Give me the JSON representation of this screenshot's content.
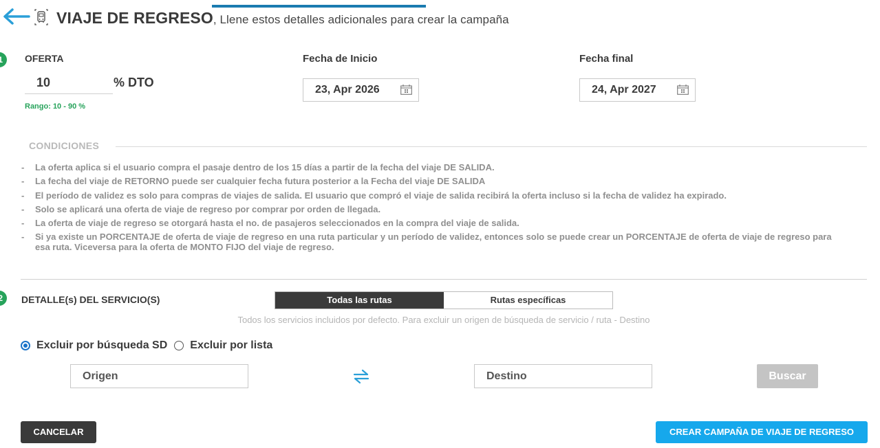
{
  "header": {
    "title": "VIAJE DE REGRESO",
    "subtitle": ", Llene estos detalles adicionales para crear la campaña",
    "back_icon": "back-arrow-icon",
    "bus_icon": "bus-icon",
    "accent_color": "#1a7bb0"
  },
  "step1": {
    "badge": "1",
    "offer_label": "OFERTA",
    "offer_value": "10",
    "offer_unit": "% DTO",
    "range_text": "Rango: 10 - 90 %",
    "start_label": "Fecha de Inicio",
    "start_value": "23, Apr 2026",
    "end_label": "Fecha final",
    "end_value": "24, Apr 2027"
  },
  "conditions": {
    "title": "CONDICIONES",
    "items": [
      "La oferta aplica si el usuario compra el pasaje dentro de los 15 días a partir de la fecha del viaje DE SALIDA.",
      "La fecha del viaje de RETORNO puede ser cualquier fecha futura posterior a la Fecha del viaje DE SALIDA",
      "El período de validez es solo para compras de viajes de salida. El usuario que compró el viaje de salida recibirá la oferta incluso si la fecha de validez ha expirado.",
      "Solo se aplicará una oferta de viaje de regreso por comprar por orden de llegada.",
      "La oferta de viaje de regreso se otorgará hasta el no. de pasajeros seleccionados en la compra del viaje de salida.",
      "Si ya existe un PORCENTAJE de oferta de viaje de regreso en una ruta particular y un período de validez, entonces solo se puede crear un PORCENTAJE de oferta de viaje de regreso para esa ruta. Viceversa para la oferta de MONTO FIJO del viaje de regreso."
    ]
  },
  "step2": {
    "badge": "2",
    "label": "DETALLE(s) DEL SERVICIO(S)",
    "tabs": [
      {
        "label": "Todas las rutas",
        "active": true
      },
      {
        "label": "Rutas específicas",
        "active": false
      }
    ],
    "info_text": "Todos los servicios incluidos por defecto. Para excluir un origen de búsqueda de servicio / ruta - Destino",
    "radio_options": [
      {
        "label": "Excluir por búsqueda SD",
        "checked": true
      },
      {
        "label": "Excluir por lista",
        "checked": false
      }
    ],
    "origin_placeholder": "Origen",
    "destination_placeholder": "Destino",
    "search_button": "Buscar"
  },
  "footer": {
    "cancel_label": "CANCELAR",
    "create_label": "CREAR CAMPAÑA DE VIAJE DE REGRESO",
    "create_color": "#16a8ec"
  }
}
